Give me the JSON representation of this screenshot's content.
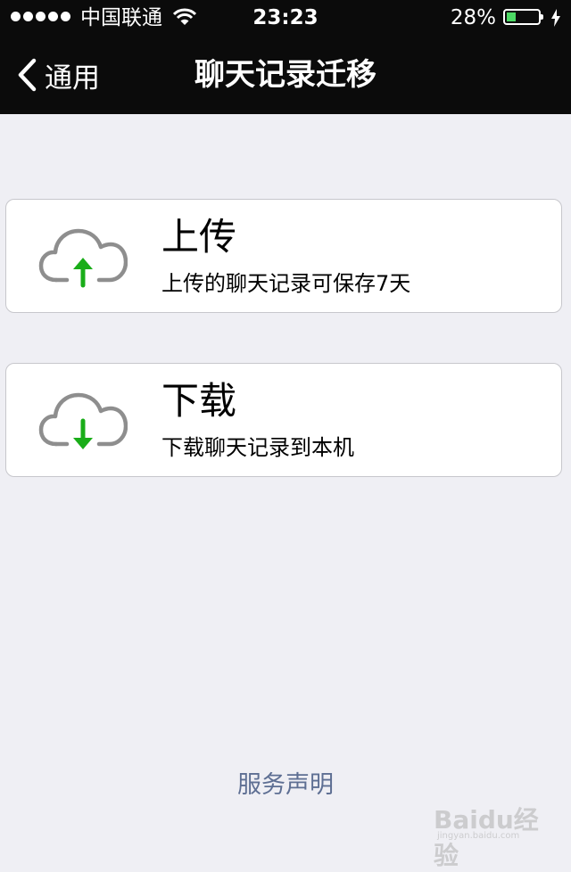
{
  "status_bar": {
    "carrier": "中国联通",
    "time": "23:23",
    "battery_percent": "28%",
    "battery_level": 0.28,
    "charging": true
  },
  "nav": {
    "back_label": "通用",
    "title": "聊天记录迁移"
  },
  "actions": {
    "upload": {
      "title": "上传",
      "description": "上传的聊天记录可保存7天",
      "icon": "cloud-upload-icon"
    },
    "download": {
      "title": "下载",
      "description": "下载聊天记录到本机",
      "icon": "cloud-download-icon"
    }
  },
  "footer": {
    "service_link": "服务声明"
  },
  "watermark": {
    "text": "Baidu经验",
    "sub": "jingyan.baidu.com"
  },
  "colors": {
    "bar_background": "#0b0b0b",
    "page_background": "#efeff4",
    "arrow_green": "#1aad19",
    "cloud_gray": "#8e8e8e",
    "link_color": "#5e6f93"
  }
}
